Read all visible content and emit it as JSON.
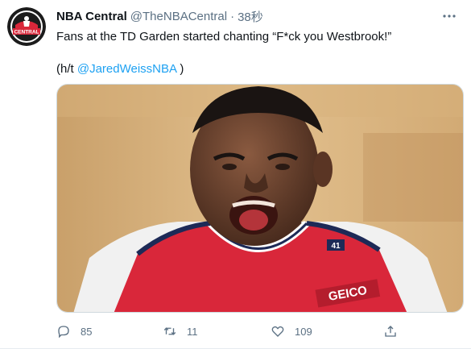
{
  "tweet": {
    "author": {
      "name": "NBA Central",
      "handle": "@TheNBACentral",
      "avatar_text": "CENTRAL"
    },
    "separator": "·",
    "time": "38秒",
    "text_line1": "Fans at the TD Garden started chanting “F*ck you Westbrook!”",
    "ht_prefix": "(h/t ",
    "ht_mention": "@JaredWeissNBA",
    "ht_suffix": " )",
    "media": {
      "jersey_number": "41",
      "sponsor": "GEICO"
    },
    "actions": {
      "reply_count": "85",
      "retweet_count": "11",
      "like_count": "109"
    }
  },
  "colors": {
    "accent": "#1da1f2",
    "muted": "#5b7083",
    "jersey_red": "#d9273a"
  },
  "icons": {
    "more": "more-icon",
    "reply": "reply-icon",
    "retweet": "retweet-icon",
    "like": "heart-icon",
    "share": "share-icon"
  }
}
